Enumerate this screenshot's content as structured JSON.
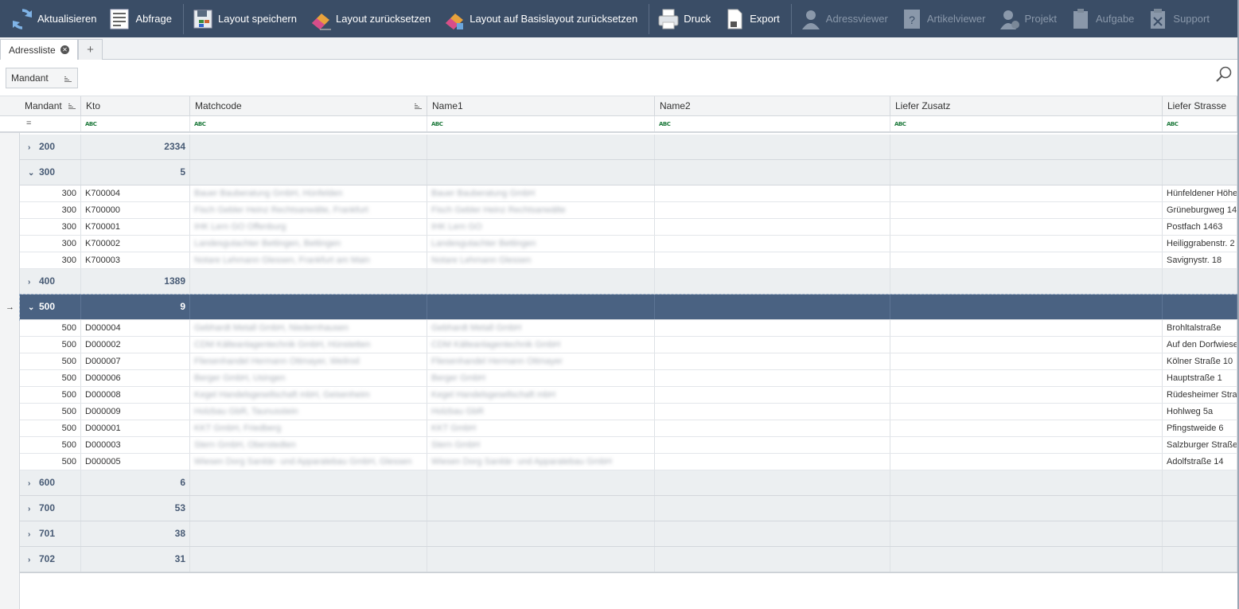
{
  "toolbar": {
    "buttons": [
      {
        "label": "Aktualisieren",
        "icon": "refresh-icon",
        "enabled": true
      },
      {
        "label": "Abfrage",
        "icon": "query-icon",
        "enabled": true
      },
      {
        "label": "Layout speichern",
        "icon": "save-layout-icon",
        "enabled": true
      },
      {
        "label": "Layout zurücksetzen",
        "icon": "eraser-icon",
        "enabled": true
      },
      {
        "label": "Layout auf Basislayout zurücksetzen",
        "icon": "eraser-base-icon",
        "enabled": true
      },
      {
        "label": "Druck",
        "icon": "printer-icon",
        "enabled": true
      },
      {
        "label": "Export",
        "icon": "export-icon",
        "enabled": true
      },
      {
        "label": "Adressviewer",
        "icon": "user-icon",
        "enabled": false
      },
      {
        "label": "Artikelviewer",
        "icon": "article-icon",
        "enabled": false
      },
      {
        "label": "Projekt",
        "icon": "project-user-icon",
        "enabled": false
      },
      {
        "label": "Aufgabe",
        "icon": "task-icon",
        "enabled": false
      },
      {
        "label": "Support",
        "icon": "clipboard-icon",
        "enabled": false
      }
    ]
  },
  "tabs": [
    {
      "label": "Adressliste"
    }
  ],
  "group_panel": {
    "chip": "Mandant"
  },
  "columns": [
    {
      "label": "Mandant"
    },
    {
      "label": "Kto"
    },
    {
      "label": "Matchcode"
    },
    {
      "label": "Name1"
    },
    {
      "label": "Name2"
    },
    {
      "label": "Liefer Zusatz"
    },
    {
      "label": "Liefer Strasse"
    }
  ],
  "groups": [
    {
      "key": "200",
      "count": "2334",
      "expanded": false,
      "rows": []
    },
    {
      "key": "300",
      "count": "5",
      "expanded": true,
      "rows": [
        {
          "mandant": "300",
          "kto": "K700004",
          "matchcode": "Bauer Bauberatung GmbH, Hünfelden",
          "name1": "Bauer Bauberatung GmbH",
          "strasse": "Hünfeldener Höhe"
        },
        {
          "mandant": "300",
          "kto": "K700000",
          "matchcode": "Fisch Gebler Heinz Rechtsanwälte, Frankfurt",
          "name1": "Fisch Gebler Heinz Rechtsanwälte",
          "strasse": "Grüneburgweg 14"
        },
        {
          "mandant": "300",
          "kto": "K700001",
          "matchcode": "IHK Lern GO Offenburg",
          "name1": "IHK Lern GO",
          "strasse": "Postfach 1463"
        },
        {
          "mandant": "300",
          "kto": "K700002",
          "matchcode": "Landesgutachter Bettingen, Bettingen",
          "name1": "Landesgutachter Bettingen",
          "strasse": "Heiliggrabenstr. 2"
        },
        {
          "mandant": "300",
          "kto": "K700003",
          "matchcode": "Notare Lehmann Glessen, Frankfurt am Main",
          "name1": "Notare Lehmann Glessen",
          "strasse": "Savignystr. 18"
        }
      ]
    },
    {
      "key": "400",
      "count": "1389",
      "expanded": false,
      "rows": []
    },
    {
      "key": "500",
      "count": "9",
      "expanded": true,
      "selected": true,
      "rows": [
        {
          "mandant": "500",
          "kto": "D000004",
          "matchcode": "Gebhardt Metall GmbH, Niedernhausen",
          "name1": "Gebhardt Metall GmbH",
          "strasse": "Brohltalstraße"
        },
        {
          "mandant": "500",
          "kto": "D000002",
          "matchcode": "CDM Kälteanlagentechnik GmbH, Hünstetten",
          "name1": "CDM Kälteanlagentechnik GmbH",
          "strasse": "Auf den Dorfwiesen"
        },
        {
          "mandant": "500",
          "kto": "D000007",
          "matchcode": "Fliesenhandel Hermann Ottmayer, Weilrod",
          "name1": "Fliesenhandel Hermann Ottmayer",
          "strasse": "Kölner Straße 10"
        },
        {
          "mandant": "500",
          "kto": "D000006",
          "matchcode": "Berger GmbH, Usingen",
          "name1": "Berger GmbH",
          "strasse": "Hauptstraße 1"
        },
        {
          "mandant": "500",
          "kto": "D000008",
          "matchcode": "Kegel Handelsgesellschaft mbH, Geisenheim",
          "name1": "Kegel Handelsgesellschaft mbH",
          "strasse": "Rüdesheimer Straße"
        },
        {
          "mandant": "500",
          "kto": "D000009",
          "matchcode": "Holzbau GbR, Taunusstein",
          "name1": "Holzbau GbR",
          "strasse": "Hohlweg 5a"
        },
        {
          "mandant": "500",
          "kto": "D000001",
          "matchcode": "KKT GmbH, Friedberg",
          "name1": "KKT GmbH",
          "strasse": "Pfingstweide 6"
        },
        {
          "mandant": "500",
          "kto": "D000003",
          "matchcode": "Stern GmbH, Oberstedten",
          "name1": "Stern GmbH",
          "strasse": "Salzburger Straße"
        },
        {
          "mandant": "500",
          "kto": "D000005",
          "matchcode": "Wiesen Dorg Sanitär- und Apparatebau GmbH, Glessen",
          "name1": "Wiesen Dorg Sanitär- und Apparatebau GmbH",
          "strasse": "Adolfstraße 14"
        }
      ]
    },
    {
      "key": "600",
      "count": "6",
      "expanded": false,
      "rows": []
    },
    {
      "key": "700",
      "count": "53",
      "expanded": false,
      "rows": []
    },
    {
      "key": "701",
      "count": "38",
      "expanded": false,
      "rows": []
    },
    {
      "key": "702",
      "count": "31",
      "expanded": false,
      "rows": []
    }
  ],
  "colors": {
    "toolbar_bg": "#3a4d66",
    "selected_row": "#4a6282",
    "group_text": "#485b75",
    "filter_abc": "#1e7a3c"
  }
}
